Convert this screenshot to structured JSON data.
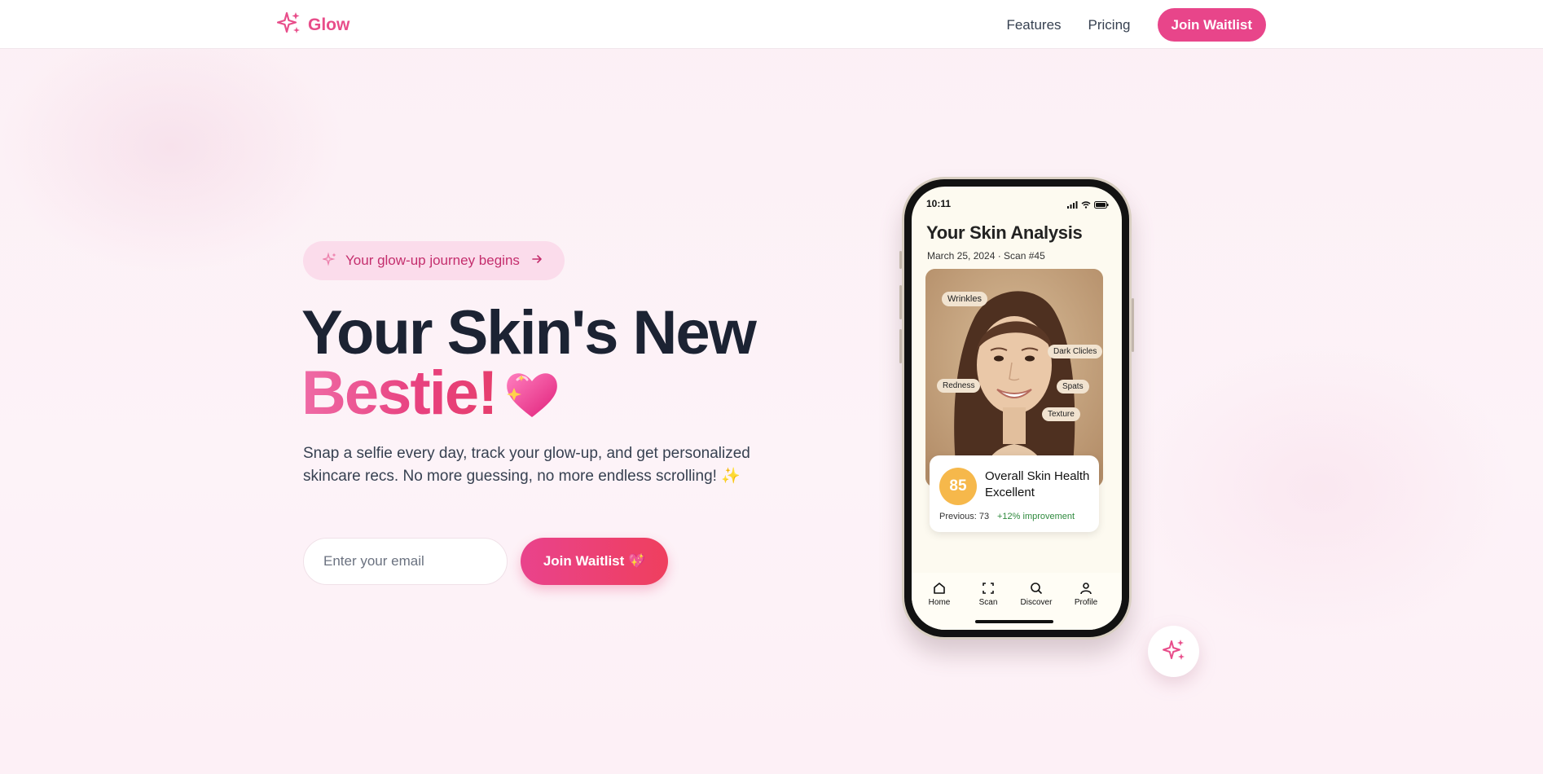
{
  "nav": {
    "brand": "Glow",
    "links": [
      "Features",
      "Pricing"
    ],
    "cta": "Join Waitlist"
  },
  "hero": {
    "pill": "Your glow-up journey begins",
    "title_line1": "Your Skin's New",
    "title_accent": "Bestie!",
    "subtitle": "Snap a selfie every day, track your glow-up, and get personalized skincare recs. No more guessing, no more endless scrolling!",
    "subtitle_emoji": "✨",
    "email_placeholder": "Enter your email",
    "cta": "Join Waitlist 💖"
  },
  "phone": {
    "time": "10:11",
    "title": "Your Skin Analysis",
    "date": "March 25, 2024 · Scan #45",
    "tags": [
      "Wrinkles",
      "Dark Clicles",
      "Redness",
      "Spats",
      "Texture"
    ],
    "score": "85",
    "score_title": "Overall Skin Health",
    "score_label": "Excellent",
    "previous": "Previous: 73",
    "improvement": "+12% improvement",
    "tabs": [
      "Home",
      "Scan",
      "Discover",
      "Profile"
    ]
  },
  "colors": {
    "brand": "#e8458a",
    "accent_gradient_end": "#ef3f5e",
    "score": "#f6b84b",
    "improvement": "#2f8a3e"
  },
  "icons": [
    "sparkles-icon",
    "arrow-right-icon",
    "heart-sparkle-icon",
    "home-icon",
    "scan-icon",
    "search-icon",
    "profile-icon"
  ]
}
